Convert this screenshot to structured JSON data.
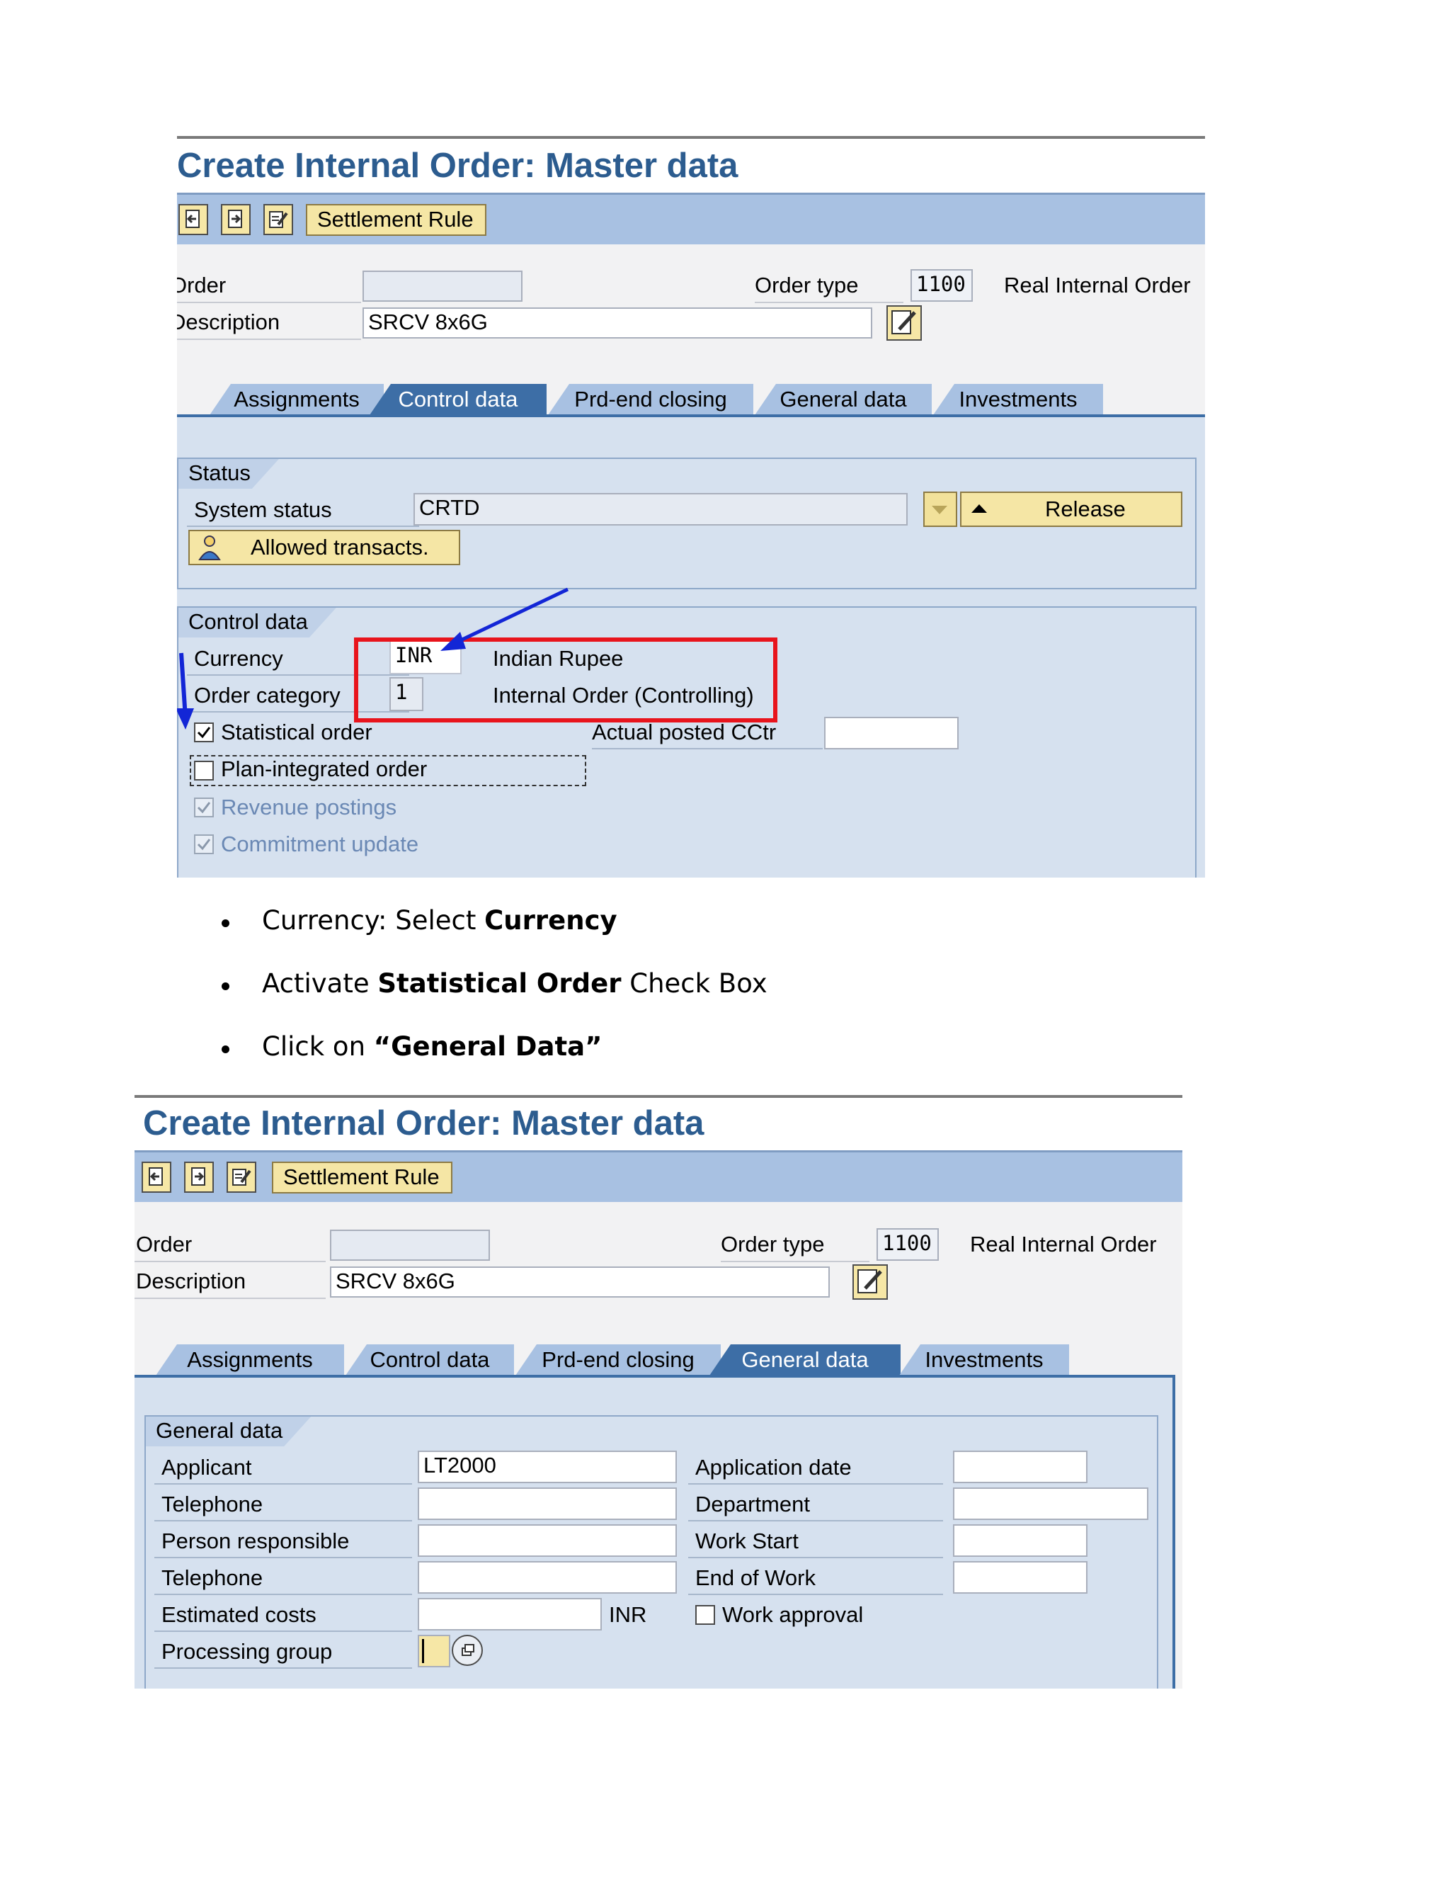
{
  "screen1": {
    "title": "Create Internal Order: Master data",
    "toolbar": {
      "settlement_rule": "Settlement Rule"
    },
    "header": {
      "order_label": "Order",
      "order_value": "",
      "description_label": "Description",
      "description_value": "SRCV 8x6G",
      "order_type_label": "Order type",
      "order_type_value": "1100",
      "order_type_text": "Real Internal Order"
    },
    "tabs": [
      "Assignments",
      "Control data",
      "Prd-end closing",
      "General data",
      "Investments"
    ],
    "active_tab": "Control data",
    "status_group": {
      "title": "Status",
      "system_status_label": "System status",
      "system_status_value": "CRTD",
      "release_button": "Release",
      "allowed_transacts_button": "Allowed transacts."
    },
    "control_group": {
      "title": "Control data",
      "currency_label": "Currency",
      "currency_value": "INR",
      "currency_text": "Indian Rupee",
      "order_category_label": "Order category",
      "order_category_value": "1",
      "order_category_text": "Internal Order (Controlling)",
      "statistical_order_label": "Statistical order",
      "statistical_order_checked": true,
      "actual_posted_cctr_label": "Actual posted CCtr",
      "actual_posted_cctr_value": "",
      "plan_integrated_label": "Plan-integrated order",
      "plan_integrated_checked": false,
      "revenue_postings_label": "Revenue postings",
      "revenue_postings_checked": true,
      "commitment_update_label": "Commitment update",
      "commitment_update_checked": true
    },
    "highlight_color": "#e8141c",
    "arrow_color": "#1326d6"
  },
  "instructions": [
    {
      "prefix": "Currency: Select ",
      "bold": "Currency",
      "suffix": ""
    },
    {
      "prefix": "Activate ",
      "bold": "Statistical Order",
      "suffix": " Check Box"
    },
    {
      "prefix": "Click on ",
      "bold": "“General Data”",
      "suffix": ""
    }
  ],
  "screen2": {
    "title": "Create Internal Order: Master data",
    "toolbar": {
      "settlement_rule": "Settlement Rule"
    },
    "header": {
      "order_label": "Order",
      "order_value": "",
      "description_label": "Description",
      "description_value": "SRCV 8x6G",
      "order_type_label": "Order type",
      "order_type_value": "1100",
      "order_type_text": "Real Internal Order"
    },
    "tabs": [
      "Assignments",
      "Control data",
      "Prd-end closing",
      "General data",
      "Investments"
    ],
    "active_tab": "General data",
    "general_group": {
      "title": "General data",
      "applicant_label": "Applicant",
      "applicant_value": "LT2000",
      "telephone1_label": "Telephone",
      "telephone1_value": "",
      "person_responsible_label": "Person responsible",
      "person_responsible_value": "",
      "telephone2_label": "Telephone",
      "telephone2_value": "",
      "estimated_costs_label": "Estimated costs",
      "estimated_costs_value": "",
      "estimated_costs_currency": "INR",
      "processing_group_label": "Processing group",
      "processing_group_value": "",
      "application_date_label": "Application date",
      "application_date_value": "",
      "department_label": "Department",
      "department_value": "",
      "work_start_label": "Work Start",
      "work_start_value": "",
      "end_of_work_label": "End of Work",
      "end_of_work_value": "",
      "work_approval_label": "Work approval",
      "work_approval_checked": false
    }
  }
}
